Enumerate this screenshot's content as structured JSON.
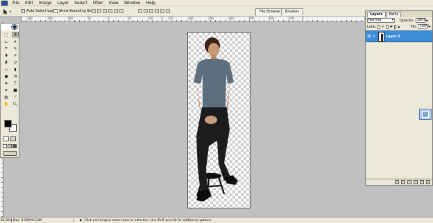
{
  "menubar": {
    "items": [
      "File",
      "Edit",
      "Image",
      "Layer",
      "Select",
      "Filter",
      "View",
      "Window",
      "Help"
    ]
  },
  "options": {
    "auto_select_label": "Auto Select Layer",
    "auto_select_checked": true,
    "bounding_box_label": "Show Bounding Box",
    "bounding_box_checked": false,
    "well_tabs": [
      "File Browser",
      "Brushes"
    ]
  },
  "ruler": {
    "top_labels": [
      "200",
      "150",
      "100",
      "50",
      "0",
      "50",
      "100",
      "150",
      "200",
      "250",
      "300",
      "350",
      "400",
      "450"
    ]
  },
  "layers": {
    "tabs": [
      "Layers",
      "Paths"
    ],
    "blend_mode": "Normal",
    "opacity_label": "Opacity:",
    "opacity_value": "100%",
    "lock_label": "Lock:",
    "fill_label": "Fill:",
    "fill_value": "100%",
    "layer_name": "Layer 0"
  },
  "status": {
    "zoom": "25.02%",
    "doc": "Doc: 5.03M/6.13M",
    "hint": "Click and drag to move layer or selection.  Use Shift and Alt for additional options."
  },
  "colors": {
    "chrome": "#ece9d8",
    "workspace": "#c0c0c0",
    "selected_layer": "#3c8cd8",
    "shirt": "#5d6f7d",
    "pants": "#1a1c1e"
  }
}
